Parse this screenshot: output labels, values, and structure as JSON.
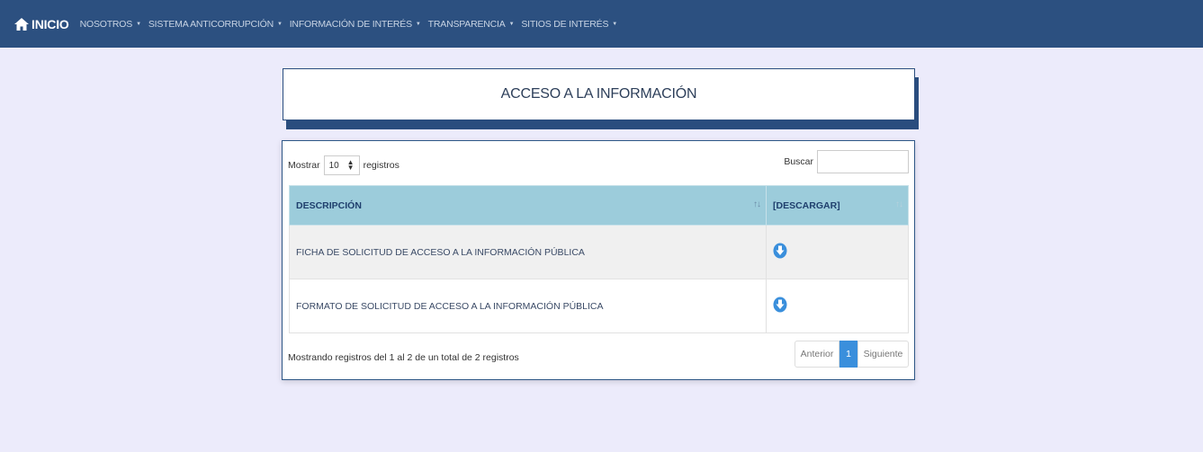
{
  "nav": {
    "home_label": "INICIO",
    "items": [
      {
        "label": "NOSOTROS"
      },
      {
        "label": "SISTEMA ANTICORRUPCIÓN"
      },
      {
        "label": "INFORMACIÓN DE INTERÉS"
      },
      {
        "label": "TRANSPARENCIA"
      },
      {
        "label": "SITIOS DE INTERÉS"
      }
    ]
  },
  "page": {
    "title": "ACCESO A LA INFORMACIÓN"
  },
  "table_controls": {
    "show_prefix": "Mostrar",
    "page_length": "10",
    "show_suffix": "registros",
    "search_label": "Buscar",
    "search_value": ""
  },
  "table": {
    "headers": [
      "DESCRIPCIÓN",
      "[DESCARGAR]"
    ],
    "rows": [
      {
        "description": "FICHA DE SOLICITUD DE ACCESO A LA INFORMACIÓN PÚBLICA",
        "download_icon": "download-circle-icon"
      },
      {
        "description": "FORMATO DE SOLICITUD DE ACCESO A LA INFORMACIÓN PÚBLICA",
        "download_icon": "download-circle-icon"
      }
    ]
  },
  "footer": {
    "info": "Mostrando registros del 1 al 2 de un total de 2 registros",
    "prev": "Anterior",
    "current_page": "1",
    "next": "Siguiente"
  },
  "colors": {
    "navbar": "#2c5080",
    "background": "#ecebfb",
    "header_row": "#9cccdb",
    "accent_blue": "#3a8fdc"
  }
}
